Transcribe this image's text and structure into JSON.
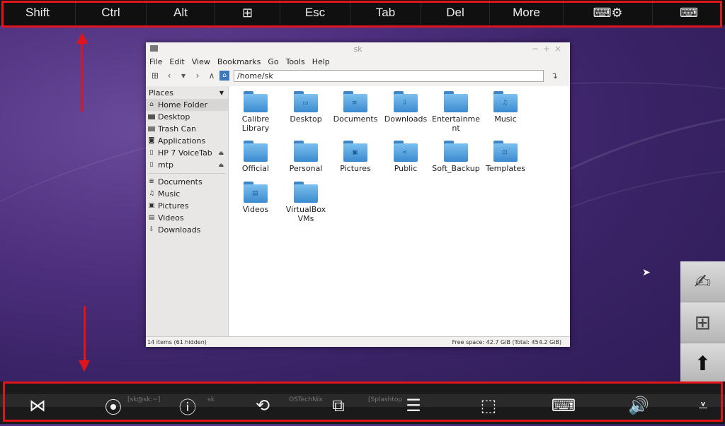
{
  "keybar": {
    "keys": [
      "Shift",
      "Ctrl",
      "Alt",
      "⊞",
      "Esc",
      "Tab",
      "Del",
      "More",
      "⌨⚙",
      "⌨"
    ]
  },
  "window": {
    "title": "sk",
    "menu": [
      "File",
      "Edit",
      "View",
      "Bookmarks",
      "Go",
      "Tools",
      "Help"
    ],
    "path": "/home/sk",
    "sidebar": {
      "header": "Places",
      "places": [
        {
          "label": "Home Folder",
          "icon": "home-icon"
        },
        {
          "label": "Desktop",
          "icon": "desktop-icon"
        },
        {
          "label": "Trash Can",
          "icon": "trash-icon"
        },
        {
          "label": "Applications",
          "icon": "applications-icon"
        },
        {
          "label": "HP 7 VoiceTab",
          "icon": "device-icon"
        },
        {
          "label": "mtp",
          "icon": "device-icon"
        }
      ],
      "bookmarks": [
        {
          "label": "Documents",
          "icon": "documents-icon"
        },
        {
          "label": "Music",
          "icon": "music-icon"
        },
        {
          "label": "Pictures",
          "icon": "pictures-icon"
        },
        {
          "label": "Videos",
          "icon": "videos-icon"
        },
        {
          "label": "Downloads",
          "icon": "downloads-icon"
        }
      ]
    },
    "folders": [
      {
        "label": "Calibre Library",
        "emblem": ""
      },
      {
        "label": "Desktop",
        "emblem": "▭"
      },
      {
        "label": "Documents",
        "emblem": "≡"
      },
      {
        "label": "Downloads",
        "emblem": "⇩"
      },
      {
        "label": "Entertainment",
        "emblem": ""
      },
      {
        "label": "Music",
        "emblem": "♫"
      },
      {
        "label": "Official",
        "emblem": ""
      },
      {
        "label": "Personal",
        "emblem": ""
      },
      {
        "label": "Pictures",
        "emblem": "▣"
      },
      {
        "label": "Public",
        "emblem": "<"
      },
      {
        "label": "Soft_Backup",
        "emblem": ""
      },
      {
        "label": "Templates",
        "emblem": "⊡"
      },
      {
        "label": "Videos",
        "emblem": "▤"
      },
      {
        "label": "VirtualBox VMs",
        "emblem": ""
      }
    ],
    "status_left": "14 items (61 hidden)",
    "status_right": "Free space: 42.7 GiB (Total: 454.2 GiB)"
  },
  "taskbar_ghost": [
    "[sk@sk:~]",
    "sk",
    "OSTechNix",
    "[Splashtop"
  ],
  "bottom_toolbar": [
    "close-keyboard-icon",
    "record-icon",
    "help-icon",
    "rotation-lock-icon",
    "screen-switch-icon",
    "menu-icon",
    "select-cursor-icon",
    "keyboard-text-icon",
    "volume-icon",
    "hide-icon"
  ],
  "colors": {
    "accent_red": "#e0141b",
    "folder_blue": "#3b8ad0"
  }
}
